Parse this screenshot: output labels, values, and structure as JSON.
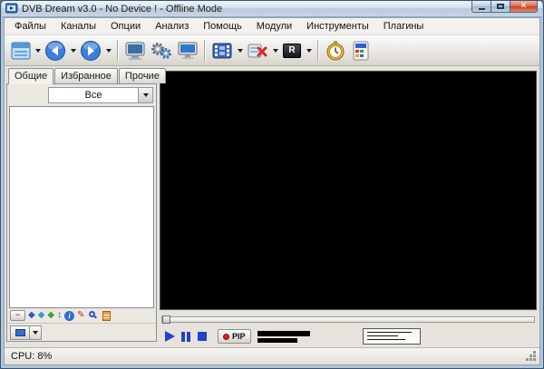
{
  "window": {
    "title": "DVB Dream v3.0 - No Device ! - Offline Mode",
    "close_glyph": "×"
  },
  "menu": {
    "items": [
      {
        "label": "Файлы"
      },
      {
        "label": "Каналы"
      },
      {
        "label": "Опции"
      },
      {
        "label": "Анализ"
      },
      {
        "label": "Помощь"
      },
      {
        "label": "Модули"
      },
      {
        "label": "Инструменты"
      },
      {
        "label": "Плагины"
      }
    ]
  },
  "toolbar": {
    "record_glyph": "R",
    "buttons": [
      {
        "name": "channel-list",
        "icon": "channel-list-icon",
        "dropdown": true
      },
      {
        "name": "previous-channel",
        "icon": "back-circle-icon",
        "dropdown": true
      },
      {
        "name": "next-channel",
        "icon": "forward-circle-icon",
        "dropdown": true
      },
      {
        "name": "tv-mode",
        "icon": "tv-icon",
        "dropdown": false
      },
      {
        "name": "settings",
        "icon": "gears-icon",
        "dropdown": false
      },
      {
        "name": "display",
        "icon": "monitor-icon",
        "dropdown": false
      },
      {
        "name": "play-media-file",
        "icon": "film-icon",
        "dropdown": true
      },
      {
        "name": "close-file",
        "icon": "red-x-icon",
        "dropdown": true
      },
      {
        "name": "record",
        "icon": "record-r-icon",
        "dropdown": true
      },
      {
        "name": "scheduler",
        "icon": "stopwatch-icon",
        "dropdown": false
      },
      {
        "name": "teletext",
        "icon": "remote-icon",
        "dropdown": false
      }
    ]
  },
  "sidebar": {
    "tabs": [
      {
        "label": "Общие",
        "active": true
      },
      {
        "label": "Избранное",
        "active": false
      },
      {
        "label": "Прочие",
        "active": false
      }
    ],
    "group_filter": {
      "value": "Все"
    },
    "channel_list": []
  },
  "icons": {
    "collapse_glyph": "−",
    "diamond_glyph": "◆",
    "updown_glyph": "↕",
    "info_glyph": "i",
    "pencil_glyph": "✎"
  },
  "player": {
    "pip_label": "PIP"
  },
  "statusbar": {
    "cpu": "CPU: 8%"
  },
  "colors": {
    "accent_blue": "#2a3ec8",
    "record_red": "#e02020",
    "video_bg": "#000000"
  }
}
